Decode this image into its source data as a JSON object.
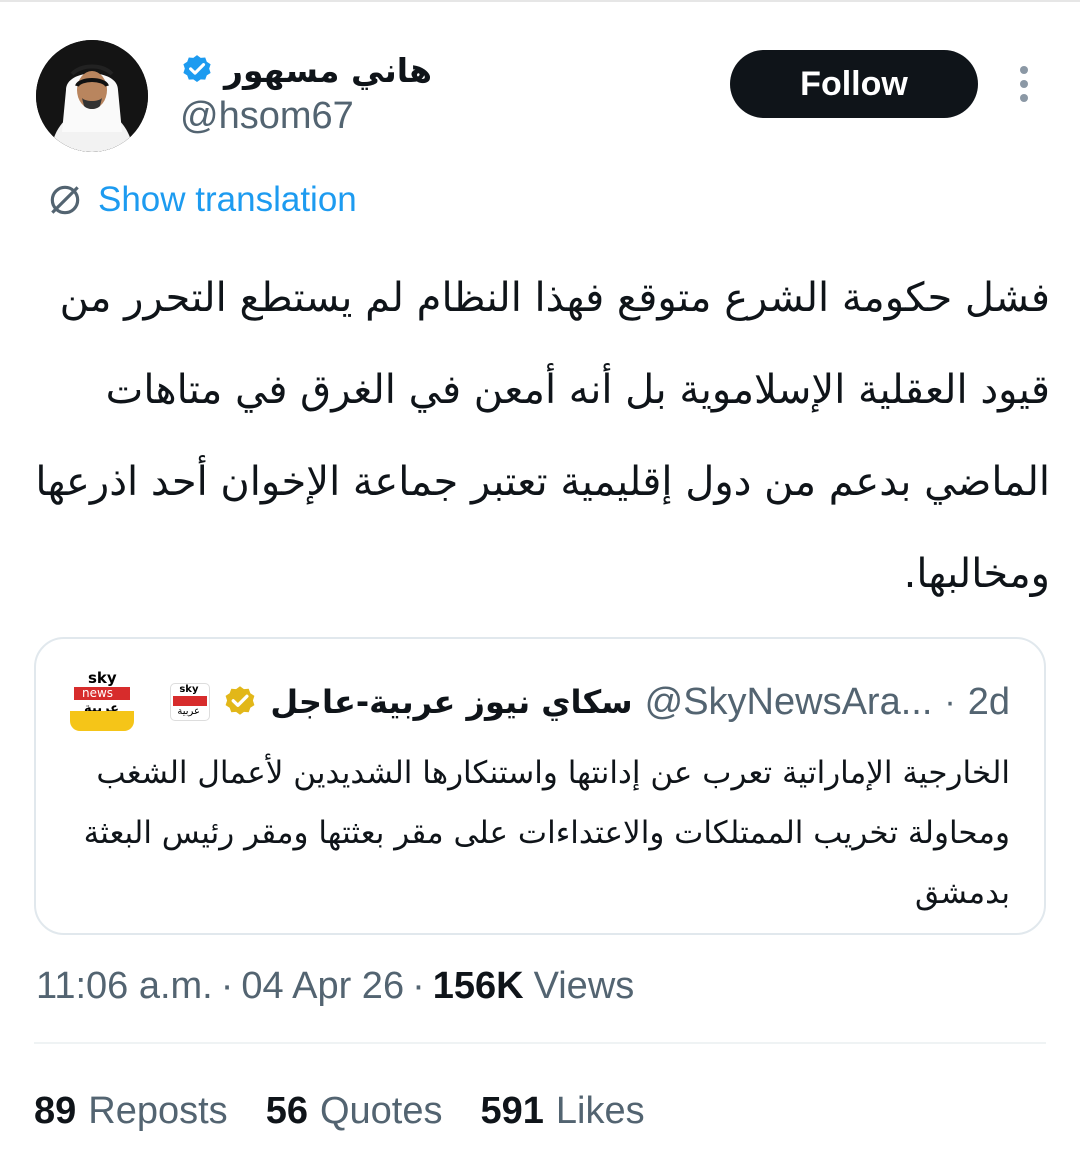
{
  "author": {
    "display_name": "هاني مسهور",
    "handle": "@hsom67",
    "verified": true,
    "verified_color": "#1d9bf0"
  },
  "actions": {
    "follow_label": "Follow",
    "more_icon": "more-vertical-icon"
  },
  "translation": {
    "label": "Show translation",
    "icon": "translate-icon",
    "color": "#1d9bf0"
  },
  "tweet": {
    "text": "فشل حكومة الشرع متوقع فهذا النظام لم يستطع التحرر من قيود العقلية الإسلاموية بل أنه أمعن في الغرق في متاهات الماضي بدعم من دول إقليمية تعتبر جماعة الإخوان أحد اذرعها ومخالبها."
  },
  "quoted_tweet": {
    "display_name": "سكاي نيوز عربية-عاجل",
    "handle": "@SkyNewsAra...",
    "separator": "·",
    "time": "2d",
    "badge_color": "#e2b719",
    "logo_text": {
      "top": "sky",
      "middle": "news",
      "bottom": "عربية"
    },
    "text": "الخارجية الإماراتية تعرب عن إدانتها واستنكارها الشديدين لأعمال الشغب ومحاولة تخريب الممتلكات والاعتداءات على مقر بعثتها ومقر رئيس البعثة بدمشق"
  },
  "meta": {
    "time": "11:06 a.m.",
    "separator": "·",
    "date": "04 Apr 26",
    "views_count": "156K",
    "views_label": "Views"
  },
  "stats": {
    "reposts_count": "89",
    "reposts_label": "Reposts",
    "quotes_count": "56",
    "quotes_label": "Quotes",
    "likes_count": "591",
    "likes_label": "Likes"
  }
}
